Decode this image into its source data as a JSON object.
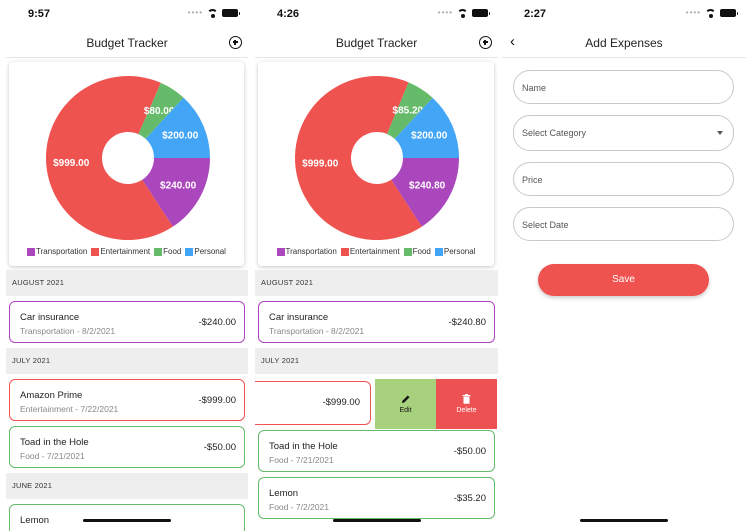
{
  "colors": {
    "transportation": "#ab47bc",
    "entertainment": "#ef5350",
    "food": "#66bb6a",
    "personal": "#42a5f5",
    "edit": "#a8d17e",
    "delete": "#ee5151",
    "save": "#ef5350"
  },
  "icons": [
    "add-circle-icon",
    "back-chevron-icon",
    "pencil-icon",
    "trash-icon",
    "wifi-icon",
    "battery-icon"
  ],
  "screens": [
    {
      "time": "9:57",
      "title": "Budget Tracker",
      "chart_labels": [
        "$240.00",
        "$999.00",
        "$80.00",
        "$200.00"
      ],
      "legend": [
        "Transportation",
        "Entertainment",
        "Food",
        "Personal"
      ],
      "sections": [
        {
          "header": "AUGUST 2021",
          "items": [
            {
              "name": "Car insurance",
              "sub": "Transportation - 8/2/2021",
              "amount": "-$240.00",
              "category": "transportation"
            }
          ]
        },
        {
          "header": "JULY 2021",
          "items": [
            {
              "name": "Amazon Prime",
              "sub": "Entertainment - 7/22/2021",
              "amount": "-$999.00",
              "category": "entertainment"
            },
            {
              "name": "Toad in the Hole",
              "sub": "Food - 7/21/2021",
              "amount": "-$50.00",
              "category": "food"
            }
          ]
        },
        {
          "header": "JUNE 2021",
          "items": [
            {
              "name": "Lemon",
              "sub": "",
              "amount": "",
              "category": "food"
            }
          ]
        }
      ]
    },
    {
      "time": "4:26",
      "title": "Budget Tracker",
      "chart_labels": [
        "$240.80",
        "$999.00",
        "$85.20",
        "$200.00"
      ],
      "legend": [
        "Transportation",
        "Entertainment",
        "Food",
        "Personal"
      ],
      "sections": [
        {
          "header": "AUGUST 2021",
          "items": [
            {
              "name": "Car insurance",
              "sub": "Transportation - 8/2/2021",
              "amount": "-$240.80",
              "category": "transportation"
            }
          ]
        },
        {
          "header": "JULY 2021",
          "swipe": {
            "amount": "-$999.00",
            "category": "entertainment",
            "edit_label": "Edit",
            "delete_label": "Delete"
          },
          "items": [
            {
              "name": "Toad in the Hole",
              "sub": "Food - 7/21/2021",
              "amount": "-$50.00",
              "category": "food"
            },
            {
              "name": "Lemon",
              "sub": "Food - 7/2/2021",
              "amount": "-$35.20",
              "category": "food"
            }
          ]
        }
      ]
    },
    {
      "time": "2:27",
      "title": "Add Expenses",
      "fields": [
        {
          "placeholder": "Name",
          "type": "text"
        },
        {
          "placeholder": "Select Category",
          "type": "select"
        },
        {
          "placeholder": "Price",
          "type": "text"
        },
        {
          "placeholder": "Select Date",
          "type": "date"
        }
      ],
      "save_label": "Save"
    }
  ],
  "chart_data": [
    {
      "type": "pie",
      "categories": [
        "Transportation",
        "Entertainment",
        "Food",
        "Personal"
      ],
      "values": [
        240.0,
        999.0,
        80.0,
        200.0
      ],
      "labels": [
        "$240.00",
        "$999.00",
        "$80.00",
        "$200.00"
      ],
      "legend": "bottom",
      "colors": [
        "#ab47bc",
        "#ef5350",
        "#66bb6a",
        "#42a5f5"
      ]
    },
    {
      "type": "pie",
      "categories": [
        "Transportation",
        "Entertainment",
        "Food",
        "Personal"
      ],
      "values": [
        240.8,
        999.0,
        85.2,
        200.0
      ],
      "labels": [
        "$240.80",
        "$999.00",
        "$85.20",
        "$200.00"
      ],
      "legend": "bottom",
      "colors": [
        "#ab47bc",
        "#ef5350",
        "#66bb6a",
        "#42a5f5"
      ]
    }
  ]
}
